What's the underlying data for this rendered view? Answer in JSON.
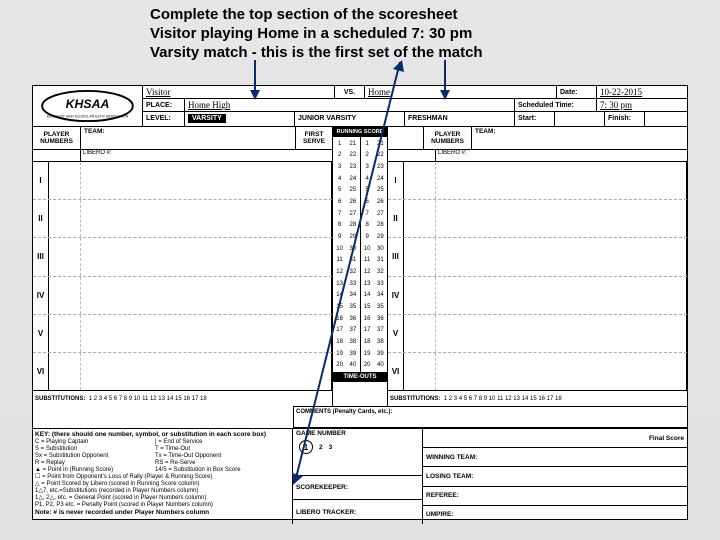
{
  "instructions": {
    "line1": "Complete the top section of the scoresheet",
    "line2": "Visitor playing Home in a scheduled 7: 30 pm",
    "line3": "Varsity match  - this is the first set of the match"
  },
  "header": {
    "vs_label": "VS.",
    "place_label": "PLACE:",
    "level_label": "LEVEL:",
    "date_label": "Date:",
    "sched_label": "Scheduled Time:",
    "start_label": "Start:",
    "finish_label": "Finish:",
    "levels": {
      "varsity": "VARSITY",
      "jv": "JUNIOR VARSITY",
      "fresh": "FRESHMAN"
    }
  },
  "handwritten": {
    "visitor": "Visitor",
    "home": "Home",
    "place": "Home High",
    "date": "10-22-2015",
    "time": "7: 30 pm"
  },
  "side": {
    "player_numbers": "PLAYER NUMBERS",
    "team": "TEAM:",
    "first_serve": "FIRST SERVE",
    "libero": "LIBERO #:",
    "romans": [
      "I",
      "II",
      "III",
      "IV",
      "V",
      "VI"
    ],
    "subs_label": "SUBSTITUTIONS:",
    "subs_nums": "1  2  3  4  5  6  7  8  9  10  11  12  13  14  15  16  17  18"
  },
  "center": {
    "running": "RUNNING SCORE",
    "timeouts": "TIME-OUTS",
    "scores_a": [
      "1",
      "2",
      "3",
      "4",
      "5",
      "6",
      "7",
      "8",
      "9",
      "10",
      "11",
      "12",
      "13",
      "14",
      "15",
      "16",
      "17",
      "18",
      "19",
      "20"
    ],
    "scores_b": [
      "21",
      "22",
      "23",
      "24",
      "25",
      "26",
      "27",
      "28",
      "29",
      "30",
      "31",
      "32",
      "33",
      "34",
      "35",
      "36",
      "37",
      "38",
      "39",
      "40"
    ]
  },
  "key": {
    "title": "KEY: (there should one number, symbol, or substitution in each score box)",
    "c": "C   =  Playing Captain",
    "s": "S   =  Substitution",
    "sx": "Sx  =  Substitution Opponent",
    "r": "R   =  Replay",
    "pt": "▲  =  Point in (Running Score)",
    "loss": "☐  =  Point from Opponent's Loss of Rally (Player & Running Score)",
    "lib": "△  =  Point Scored by Libero (scored in Running Score column)",
    "sub2": "1△7, etc.=Substitutions (recorded in Player Numbers column)",
    "gp": "1△, 2△, etc.  =  General Point  (scored in Player Numbers column)",
    "pp": "P1, P2, P3 etc.  =  Penalty Point  (scored in Player Numbers column)",
    "note": "Note:  # is never recorded under Player Numbers column",
    "eos": "|   =  End of Service",
    "tout": "T   =  Time-Out",
    "tx": "Tx  =  Time-Out Opponent",
    "rs": "RS  =  Re-Serve",
    "box": "14/5 =  Substitution in Box Score"
  },
  "bottom": {
    "game_number": "GAME NUMBER",
    "games": [
      "1",
      "2",
      "3"
    ],
    "scorekeeper": "SCOREKEEPER:",
    "libero_tracker": "LIBERO TRACKER:",
    "comments": "COMMENTS (Penalty Cards, etc.):",
    "final_score": "Final Score",
    "winning": "WINNING TEAM:",
    "losing": "LOSING TEAM:",
    "referee": "REFEREE:",
    "umpire": "UMPIRE:"
  }
}
